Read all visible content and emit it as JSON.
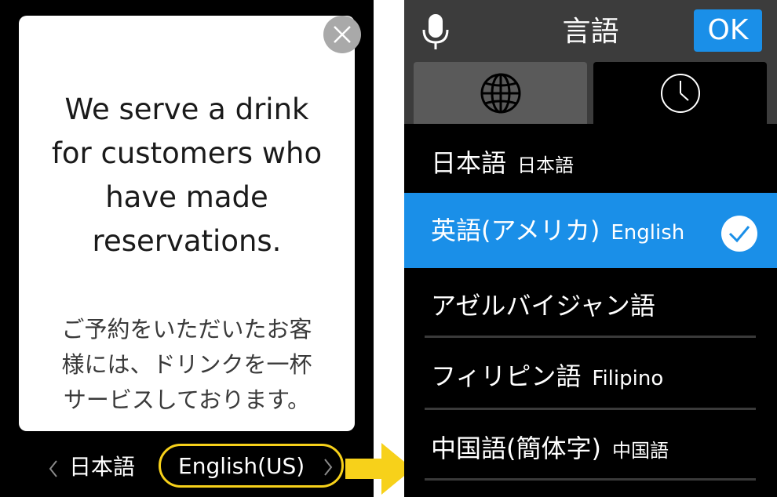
{
  "left": {
    "card": {
      "english_text": [
        "We serve a drink",
        "for customers who",
        "have made",
        "reservations."
      ],
      "japanese_text": [
        "ご予約をいただいたお客",
        "様には、ドリンクを一杯",
        "サービスしております。"
      ]
    },
    "switcher": {
      "prev_label": "日本語",
      "current_label": "English(US)"
    }
  },
  "right": {
    "header": {
      "title": "言語",
      "ok_label": "OK"
    },
    "languages": [
      {
        "primary": "日本語",
        "secondary": "日本語"
      },
      {
        "primary": "英語(アメリカ)",
        "secondary": "English"
      },
      {
        "primary": "アゼルバイジャン語",
        "secondary": ""
      },
      {
        "primary": "フィリピン語",
        "secondary": "Filipino"
      },
      {
        "primary": "中国語(簡体字)",
        "secondary": "中国語"
      }
    ]
  },
  "colors": {
    "accent_blue": "#1a8fe8",
    "highlight_yellow": "#f7d11a",
    "close_gray": "#a9a9a9"
  },
  "icons": [
    "close-icon",
    "chevron-left-icon",
    "chevron-right-icon",
    "arrow-right-icon",
    "microphone-icon",
    "globe-icon",
    "clock-icon",
    "checkmark-icon"
  ]
}
